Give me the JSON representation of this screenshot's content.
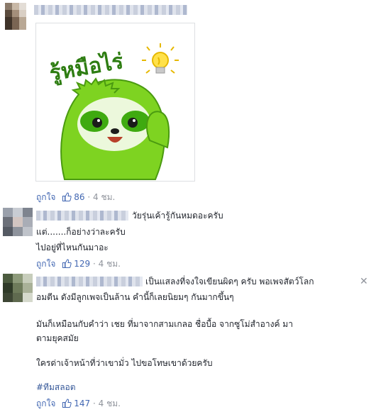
{
  "comments": [
    {
      "sticker_text": "รู้หมือไร่",
      "like_label": "ถูกใจ",
      "like_count": "86",
      "time": "4 ชม.",
      "separator": "·"
    },
    {
      "lines": [
        "วัยรุ่นเค้ารู้กันหมดอะครับ",
        "แต่.......ก็อย่างว่าละครับ",
        "ไปอยู่ที่ไหนกันมาอะ"
      ],
      "like_label": "ถูกใจ",
      "like_count": "129",
      "time": "4 ชม.",
      "separator": "·"
    },
    {
      "lines": [
        "เป็นแสลงที่จงใจเขียนผิดๆ ครับ พอเพจสัตว์โลก",
        "อมตีน ดังมีลูกเพจเป็นล้าน คำนี้ก็เลยนิยมๆ กันมากขึ้นๆ",
        "มันก็เหมือนกับคำว่า เชย ที่มาจากสามเกลอ ชื่อบื้อ จากซูโม่สำอางค์ มา",
        "ตามยุคสมัย",
        "ใครด่าเจ้าหน้าที่ว่าเขามั่ว ไปขอโทษเขาด้วยครับ",
        "#ทีมสลอต"
      ],
      "like_label": "ถูกใจ",
      "like_count": "147",
      "time": "4 ชม.",
      "separator": "·",
      "close_symbol": "✕"
    }
  ],
  "colors": {
    "link": "#4267b2",
    "meta": "#90949c",
    "text": "#1d2129",
    "sloth": "#7ed321"
  },
  "icons": [
    "thumbs-up-icon",
    "lightbulb-icon",
    "close-icon"
  ]
}
